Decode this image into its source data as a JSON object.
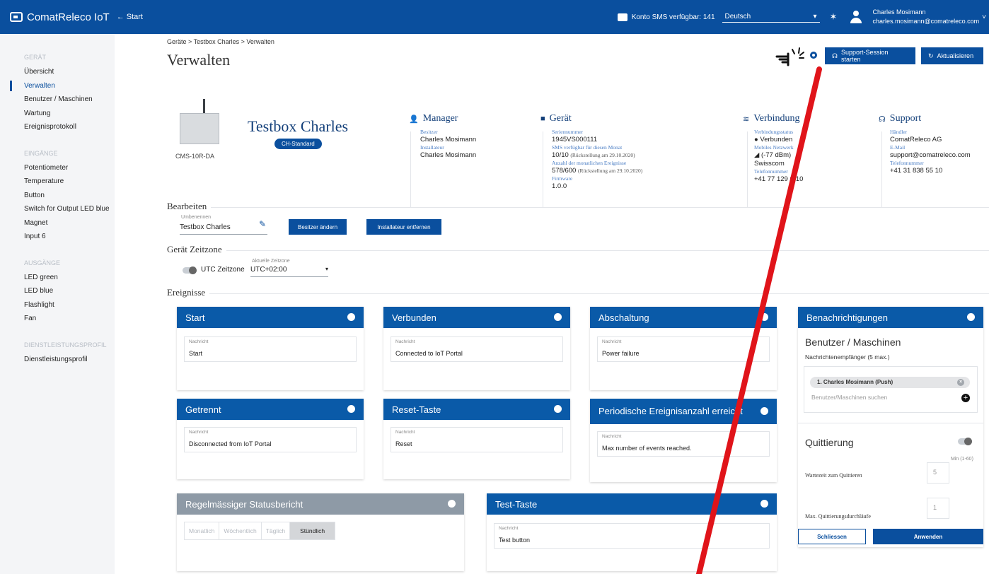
{
  "topbar": {
    "brand": "ComatReleco IoT",
    "back_label": "Start",
    "sms_label": "Konto SMS verfügbar: 141",
    "language": "Deutsch",
    "user_name": "Charles Mosimann",
    "user_email": "charles.mosimann@comatreleco.com",
    "accent": "#0a4f9e"
  },
  "sidebar": {
    "sections": [
      {
        "title": "GERÄT",
        "items": [
          "Übersicht",
          "Verwalten",
          "Benutzer / Maschinen",
          "Wartung",
          "Ereignisprotokoll"
        ]
      },
      {
        "title": "EINGÄNGE",
        "items": [
          "Potentiometer",
          "Temperature",
          "Button",
          "Switch for Output LED blue",
          "Magnet",
          "Input 6"
        ]
      },
      {
        "title": "AUSGÄNGE",
        "items": [
          "LED green",
          "LED blue",
          "Flashlight",
          "Fan"
        ]
      },
      {
        "title": "DIENSTLEISTUNGSPROFIL",
        "items": [
          "Dienstleistungsprofil"
        ]
      }
    ],
    "active": "Verwalten"
  },
  "header": {
    "breadcrumb": "Geräte > Testbox Charles > Verwalten",
    "title": "Verwalten",
    "support_button": "Support-Session starten",
    "refresh_button": "Aktualisieren"
  },
  "device": {
    "name": "Testbox Charles",
    "badge": "CH-Standard",
    "model": "CMS-10R-DA"
  },
  "manager": {
    "heading": "Manager",
    "owner_label": "Besitzer",
    "owner": "Charles Mosimann",
    "installer_label": "Installateur",
    "installer": "Charles Mosimann"
  },
  "geraet": {
    "heading": "Gerät",
    "serial_label": "Seriennummer",
    "serial": "1945VS000111",
    "sms_label": "SMS verfügbar für diesen Monat",
    "sms_value": "10/10",
    "sms_note": "(Rückstellung am 29.10.2020)",
    "events_label": "Anzahl der monatlichen Ereignisse",
    "events_value": "578/600",
    "events_note": "(Rückstellung am 29.10.2020)",
    "firmware_label": "Firmware",
    "firmware": "1.0.0"
  },
  "verbindung": {
    "heading": "Verbindung",
    "status_label": "Verbindungsstatus",
    "status": "● Verbunden",
    "network_label": "Mobiles Netzwerk",
    "network": "◢ (-77 dBm)",
    "provider": "Swisscom",
    "phone_label": "Telefonnummer",
    "phone": "+41 77 129 ■ 10"
  },
  "support": {
    "heading": "Support",
    "dealer_label": "Händler",
    "dealer": "ComatReleco AG",
    "email_label": "E-Mail",
    "email": "support@comatreleco.com",
    "phone_label": "Telefonnummer",
    "phone": "+41 31 838 55 10"
  },
  "bearbeiten": {
    "title": "Bearbeiten",
    "rename_label": "Umbenennen",
    "rename_value": "Testbox Charles",
    "owner_button": "Besitzer ändern",
    "installer_button": "Installateur entfernen"
  },
  "zeitzone": {
    "title": "Gerät Zeitzone",
    "utc_label": "UTC Zeitzone",
    "current_label": "Aktuelle Zeitzone",
    "current_value": "UTC+02:00"
  },
  "ereignisse": {
    "title": "Ereignisse",
    "message_label": "Nachricht",
    "cards": [
      {
        "title": "Start",
        "message": "Start"
      },
      {
        "title": "Verbunden",
        "message": "Connected to IoT Portal"
      },
      {
        "title": "Abschaltung",
        "message": "Power failure"
      },
      {
        "title": "Getrennt",
        "message": "Disconnected from IoT Portal"
      },
      {
        "title": "Reset-Taste",
        "message": "Reset"
      },
      {
        "title": "Periodische Ereignisanzahl erreicht",
        "message": "Max number of events reached."
      },
      {
        "title": "Test-Taste",
        "message": "Test button"
      }
    ],
    "status_report": {
      "title": "Regelmässiger Statusbericht",
      "options": [
        "Monatlich",
        "Wöchentlich",
        "Täglich",
        "Stündlich"
      ],
      "selected": "Stündlich"
    }
  },
  "notifications": {
    "title": "Benachrichtigungen",
    "users_title": "Benutzer / Maschinen",
    "recipients_label": "Nachrichtenempfänger (5 max.)",
    "recipient": "1. Charles Mosimann (Push)",
    "search_placeholder": "Benutzer/Maschinen suchen",
    "quittierung_title": "Quittierung",
    "min_hint": "Min (1-60)",
    "wait_label": "Wartezeit zum Quittieren",
    "wait_value": "5",
    "max_label": "Max. Quittierungsdurchläufe",
    "max_value": "1",
    "close_button": "Schliessen",
    "apply_button": "Anwenden"
  }
}
